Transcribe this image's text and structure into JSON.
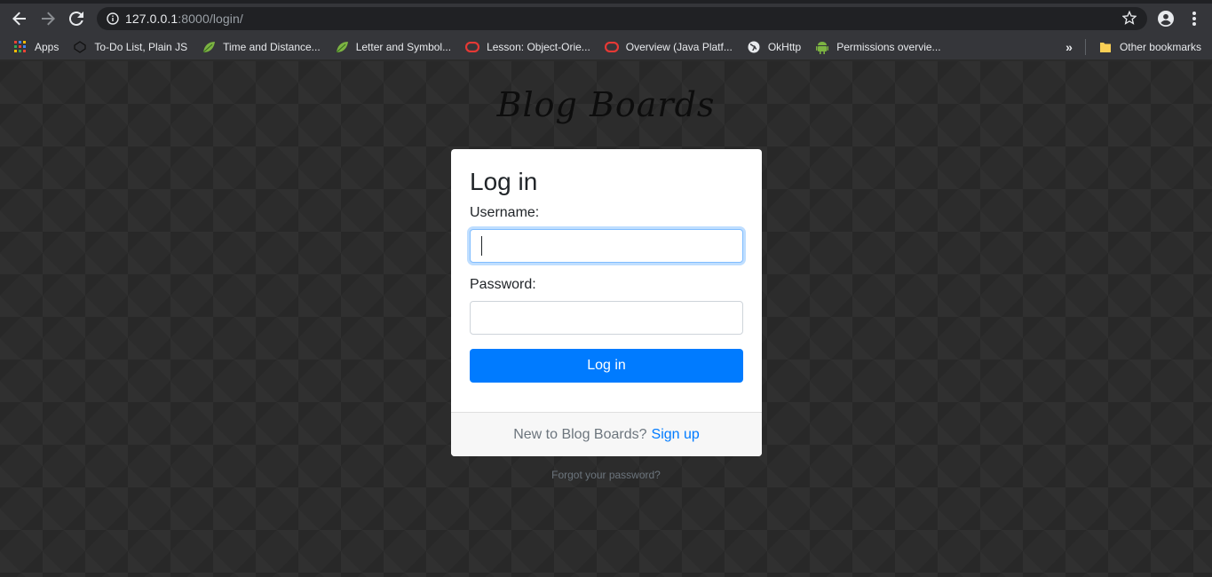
{
  "browser": {
    "url_host": "127.0.0.1",
    "url_path": ":8000/login/",
    "bookmarks": [
      {
        "label": "Apps",
        "icon": "apps-grid-icon"
      },
      {
        "label": "To-Do List, Plain JS",
        "icon": "codepen-icon"
      },
      {
        "label": "Time and Distance...",
        "icon": "leaf-icon"
      },
      {
        "label": "Letter and Symbol...",
        "icon": "leaf-icon"
      },
      {
        "label": "Lesson: Object-Orie...",
        "icon": "oracle-icon"
      },
      {
        "label": "Overview (Java Platf...",
        "icon": "oracle-icon"
      },
      {
        "label": "OkHttp",
        "icon": "globe-icon"
      },
      {
        "label": "Permissions overvie...",
        "icon": "android-icon"
      }
    ],
    "more_label": "»",
    "other_bookmarks": "Other bookmarks"
  },
  "page": {
    "brand": "Blog Boards",
    "title": "Log in",
    "username_label": "Username:",
    "password_label": "Password:",
    "submit_label": "Log in",
    "footer_text": "New to Blog Boards?",
    "signup_link": "Sign up",
    "forgot_link": "Forgot your password?"
  },
  "colors": {
    "primary": "#007bff",
    "background": "#2c2c2c",
    "chrome": "#35363a"
  }
}
